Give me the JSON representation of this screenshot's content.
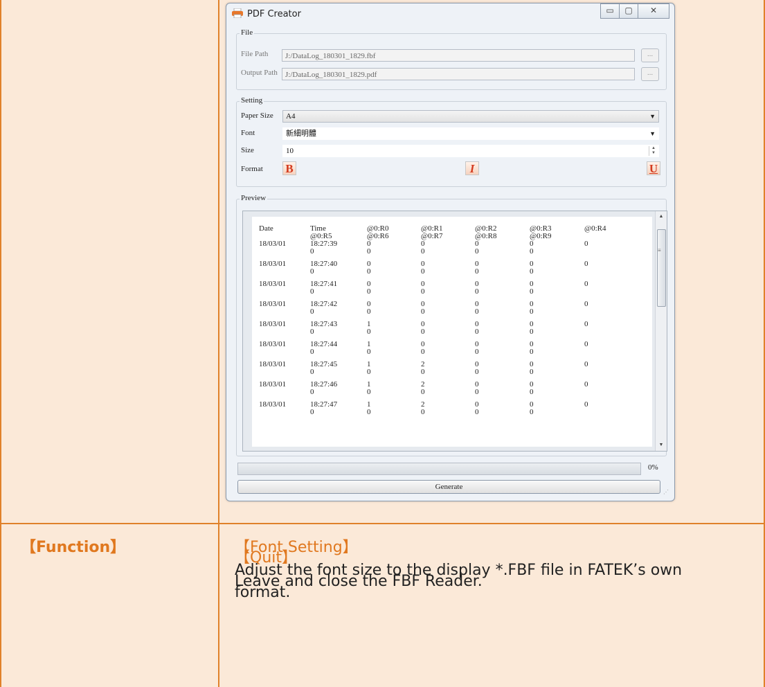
{
  "window": {
    "title": "PDF Creator",
    "buttons": {
      "minimize": "▭",
      "maximize": "▢",
      "close": "✕"
    }
  },
  "file_group": {
    "label": "File",
    "file_path_label": "File Path",
    "file_path_value": "J:/DataLog_180301_1829.fbf",
    "output_path_label": "Output Path",
    "output_path_value": "J:/DataLog_180301_1829.pdf",
    "browse_label": "..."
  },
  "setting_group": {
    "label": "Setting",
    "paper_size_label": "Paper Size",
    "paper_size_value": "A4",
    "font_label": "Font",
    "font_value": "新細明體",
    "size_label": "Size",
    "size_value": "10",
    "format_label": "Format",
    "bold_label": "B",
    "italic_label": "I",
    "underline_label": "U"
  },
  "preview_group": {
    "label": "Preview",
    "header_row1": [
      "Date",
      "Time",
      "@0:R0",
      "@0:R1",
      "@0:R2",
      "@0:R3",
      "@0:R4"
    ],
    "header_row2": [
      "@0:R5",
      "@0:R6",
      "@0:R7",
      "@0:R8",
      "@0:R9"
    ],
    "rows": [
      {
        "date": "18/03/01",
        "time": "18:27:39",
        "r": [
          "0",
          "0",
          "0",
          "0",
          "0"
        ],
        "r2": [
          "0",
          "0",
          "0",
          "0",
          "0"
        ]
      },
      {
        "date": "18/03/01",
        "time": "18:27:40",
        "r": [
          "0",
          "0",
          "0",
          "0",
          "0"
        ],
        "r2": [
          "0",
          "0",
          "0",
          "0",
          "0"
        ]
      },
      {
        "date": "18/03/01",
        "time": "18:27:41",
        "r": [
          "0",
          "0",
          "0",
          "0",
          "0"
        ],
        "r2": [
          "0",
          "0",
          "0",
          "0",
          "0"
        ]
      },
      {
        "date": "18/03/01",
        "time": "18:27:42",
        "r": [
          "0",
          "0",
          "0",
          "0",
          "0"
        ],
        "r2": [
          "0",
          "0",
          "0",
          "0",
          "0"
        ]
      },
      {
        "date": "18/03/01",
        "time": "18:27:43",
        "r": [
          "1",
          "0",
          "0",
          "0",
          "0"
        ],
        "r2": [
          "0",
          "0",
          "0",
          "0",
          "0"
        ]
      },
      {
        "date": "18/03/01",
        "time": "18:27:44",
        "r": [
          "1",
          "0",
          "0",
          "0",
          "0"
        ],
        "r2": [
          "0",
          "0",
          "0",
          "0",
          "0"
        ]
      },
      {
        "date": "18/03/01",
        "time": "18:27:45",
        "r": [
          "1",
          "2",
          "0",
          "0",
          "0"
        ],
        "r2": [
          "0",
          "0",
          "0",
          "0",
          "0"
        ]
      },
      {
        "date": "18/03/01",
        "time": "18:27:46",
        "r": [
          "1",
          "2",
          "0",
          "0",
          "0"
        ],
        "r2": [
          "0",
          "0",
          "0",
          "0",
          "0"
        ]
      },
      {
        "date": "18/03/01",
        "time": "18:27:47",
        "r": [
          "1",
          "2",
          "0",
          "0",
          "0"
        ],
        "r2": [
          "0",
          "0",
          "0",
          "0",
          "0"
        ]
      }
    ]
  },
  "progress": {
    "value": 0,
    "label": "0%"
  },
  "generate_label": "Generate",
  "doc": {
    "quit_title": "【Quit】",
    "quit_desc": "Leave and close the FBF Reader.",
    "function_label": "【Function】",
    "font_setting_title": "【Font Setting】",
    "font_setting_desc_line1": "Adjust the font size to the display *.FBF file in FATEK’s own",
    "font_setting_desc_line2": "format."
  },
  "colors": {
    "accent": "#e0781f",
    "cell_bg": "#fbe9d8",
    "border": "#e0812a"
  }
}
